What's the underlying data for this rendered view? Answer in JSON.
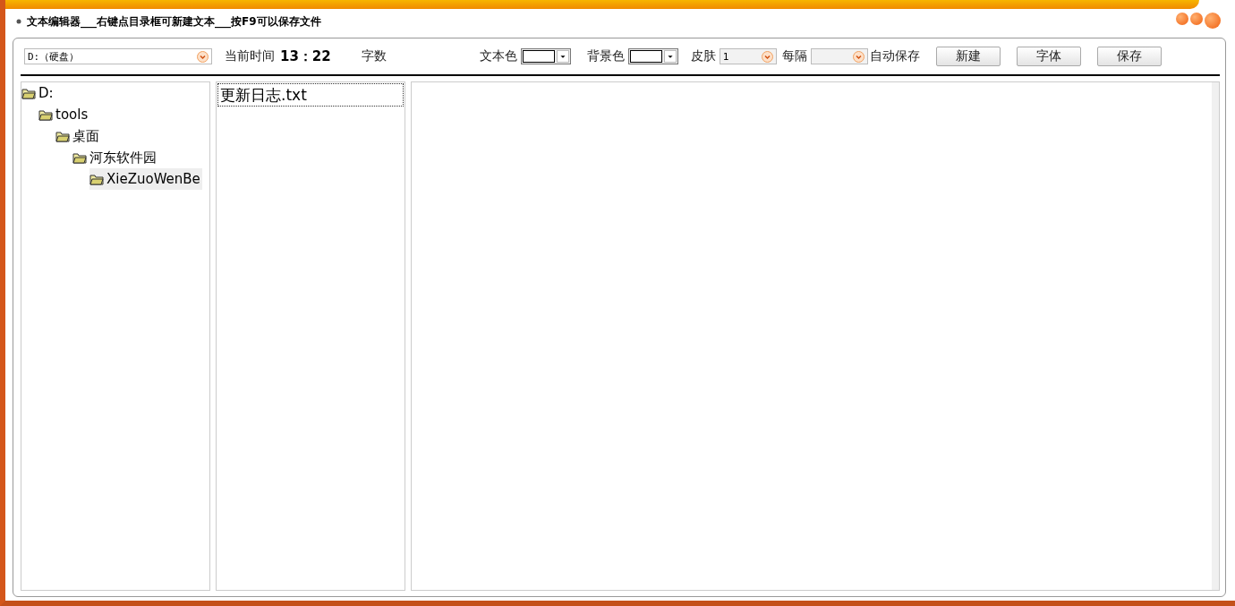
{
  "window": {
    "title": "文本编辑器___右键点目录框可新建文本___按F9可以保存文件"
  },
  "toolbar": {
    "drive": {
      "value": "D:（硬盘）"
    },
    "time_label": "当前时间",
    "time": "13：22",
    "count_label": "字数",
    "text_color": {
      "label": "文本色",
      "color": "#ffffff"
    },
    "bg_color": {
      "label": "背景色",
      "color": "#ffffff"
    },
    "skin": {
      "label": "皮肤",
      "value": "1"
    },
    "interval": {
      "label": "每隔"
    },
    "autosave_label": "自动保存",
    "buttons": [
      "新建",
      "字体",
      "保存"
    ]
  },
  "tree": [
    {
      "label": "D:",
      "selected": false,
      "children": [
        {
          "label": "tools",
          "selected": false,
          "children": [
            {
              "label": "桌面",
              "selected": false,
              "children": [
                {
                  "label": "河东软件园",
                  "selected": false,
                  "children": [
                    {
                      "label": "XieZuoWenBe",
                      "selected": true
                    }
                  ]
                }
              ]
            }
          ]
        }
      ]
    }
  ],
  "files": [
    {
      "name": "更新日志.txt",
      "selected": true
    }
  ]
}
